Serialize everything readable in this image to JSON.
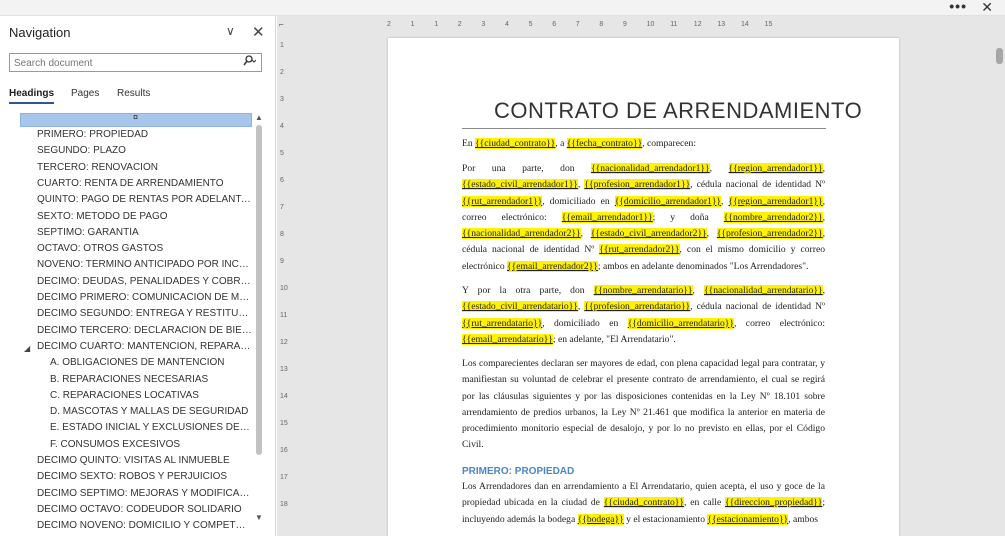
{
  "window": {
    "more_label": "•••",
    "close_label": "✕"
  },
  "navigation": {
    "title": "Navigation",
    "options_icon": "chevron-down-icon",
    "options_label": "∨",
    "close_label": "✕",
    "search": {
      "placeholder": "Search document",
      "icon": "search-icon"
    },
    "tabs": [
      "Headings",
      "Pages",
      "Results"
    ],
    "selected_label": "¤",
    "headings": [
      "PRIMERO: PROPIEDAD",
      "SEGUNDO: PLAZO",
      "TERCERO: RENOVACIÓN",
      "CUARTO: RENTA DE ARRENDAMIENTO",
      "QUINTO: PAGO DE RENTAS POR ADELANTADO",
      "SEXTO: MÉTODO DE PAGO",
      "SÉPTIMO: GARANTÍA",
      "OCTAVO: OTROS GASTOS",
      "NOVENO: TÉRMINO ANTICIPADO POR INCUMPLI...",
      "DÉCIMO: DEUDAS, PENALIDADES Y COBRANZA",
      "DÉCIMO PRIMERO: COMUNICACIÓN DE MOROS...",
      "DÉCIMO SEGUNDO: ENTREGA Y RESTITUCIÓN D...",
      "DÉCIMO TERCERO: DECLARACIÓN DE BIENES M...",
      "DÉCIMO CUARTO: MANTENCIÓN, REPARACIONE..."
    ],
    "subheadings": [
      "A. OBLIGACIONES DE MANTENCIÓN",
      "B. REPARACIONES NECESARIAS",
      "C. REPARACIONES LOCATIVAS",
      "D. MASCOTAS Y MALLAS DE SEGURIDAD",
      "E. ESTADO INICIAL Y EXCLUSIONES DE RESPO...",
      "F. CONSUMOS EXCESIVOS"
    ],
    "headings_after": [
      "DÉCIMO QUINTO: VISITAS AL INMUEBLE",
      "DÉCIMO SEXTO: ROBOS Y PERJUICIOS",
      "DÉCIMO SÉPTIMO: MEJORAS Y MODIFICACIONES",
      "DÉCIMO OCTAVO: CODEUDOR SOLIDARIO",
      "DÉCIMO NOVENO: DOMICILIO Y COMPETENCIA"
    ]
  },
  "ruler": {
    "horizontal": [
      "2",
      "1",
      "1",
      "2",
      "3",
      "4",
      "5",
      "6",
      "7",
      "8",
      "9",
      "10",
      "11",
      "12",
      "13",
      "14",
      "15"
    ],
    "vertical": [
      "1",
      "2",
      "3",
      "4",
      "5",
      "6",
      "7",
      "8",
      "9",
      "10",
      "11",
      "12",
      "13",
      "14",
      "15",
      "16",
      "17",
      "18"
    ]
  },
  "document": {
    "title": "CONTRATO DE ARRENDAMIENTO",
    "p1": [
      {
        "t": "En "
      },
      {
        "t": "{{ciudad_contrato}}",
        "h": true
      },
      {
        "t": ", a "
      },
      {
        "t": "{{fecha_contrato}}",
        "h": true
      },
      {
        "t": ", comparecen:"
      }
    ],
    "p2": [
      {
        "t": "Por una parte, don "
      },
      {
        "t": "{{nacionalidad_arrendador1}}",
        "h": true
      },
      {
        "t": ", "
      },
      {
        "t": "{{region_arrendador1}}",
        "h": true
      },
      {
        "t": ", "
      },
      {
        "t": "{{estado_civil_arrendador1}}",
        "h": true
      },
      {
        "t": ", "
      },
      {
        "t": "{{profesion_arrendador1}}",
        "h": true
      },
      {
        "t": ", cédula nacional de identidad Nº "
      },
      {
        "t": "{{rut_arrendador1}}",
        "h": true
      },
      {
        "t": ", domiciliado en "
      },
      {
        "t": "{{domicilio_arrendador1}}",
        "h": true
      },
      {
        "t": ", "
      },
      {
        "t": "{{region_arrendador1}}",
        "h": true
      },
      {
        "t": ", correo electrónico: "
      },
      {
        "t": "{{email_arrendador1}}",
        "h": true
      },
      {
        "t": "; y doña "
      },
      {
        "t": "{{nombre_arrendador2}}",
        "h": true
      },
      {
        "t": ", "
      },
      {
        "t": "{{nacionalidad_arrendador2}}",
        "h": true
      },
      {
        "t": ", "
      },
      {
        "t": "{{estado_civil_arrendador2}}",
        "h": true
      },
      {
        "t": ", "
      },
      {
        "t": "{{profesion_arrendador2}}",
        "h": true
      },
      {
        "t": ", cédula nacional de identidad Nº "
      },
      {
        "t": "{{rut_arrendador2}}",
        "h": true
      },
      {
        "t": ", con el mismo domicilio y correo electrónico "
      },
      {
        "t": "{{email_arrendador2}}",
        "h": true
      },
      {
        "t": "; ambos en adelante denominados \"Los Arrendadores\"."
      }
    ],
    "p3": [
      {
        "t": "Y por la otra parte, don "
      },
      {
        "t": "{{nombre_arrendatario}}",
        "h": true
      },
      {
        "t": ", "
      },
      {
        "t": "{{nacionalidad_arrendatario}}",
        "h": true
      },
      {
        "t": ", "
      },
      {
        "t": "{{estado_civil_arrendatario}}",
        "h": true
      },
      {
        "t": ", "
      },
      {
        "t": "{{profesion_arrendatario}}",
        "h": true
      },
      {
        "t": ", cédula nacional de identidad Nº "
      },
      {
        "t": "{{rut_arrendatario}}",
        "h": true
      },
      {
        "t": ", domiciliado en "
      },
      {
        "t": "{{domicilio_arrendatario}}",
        "h": true
      },
      {
        "t": ", correo electrónico: "
      },
      {
        "t": "{{email_arrendatario}}",
        "h": true
      },
      {
        "t": "; en adelante, \"El Arrendatario\"."
      }
    ],
    "p4": [
      {
        "t": "Los comparecientes declaran ser mayores de edad, con plena capacidad legal para contratar, y manifiestan su voluntad de celebrar el presente contrato de arrendamiento, el cual se regirá por las cláusulas siguientes y por las disposiciones contenidas en la Ley Nº 18.101 sobre arrendamiento de predios urbanos, la Ley Nº 21.461 que modifica la anterior en materia de procedimiento monitorio especial de desalojo, y por lo no previsto en ellas, por el Código Civil."
      }
    ],
    "section_heading": "PRIMERO: PROPIEDAD",
    "p5": [
      {
        "t": "Los Arrendadores dan en arrendamiento a El Arrendatario, quien acepta, el uso y goce de la propiedad ubicada en la ciudad de "
      },
      {
        "t": "{{ciudad_contrato}}",
        "h": true
      },
      {
        "t": ", en calle "
      },
      {
        "t": "{{direccion_propiedad}}",
        "h": true
      },
      {
        "t": "; incluyendo además la bodega "
      },
      {
        "t": "{{bodega}}",
        "h": true
      },
      {
        "t": " y el estacionamiento "
      },
      {
        "t": "{{estacionamiento}}",
        "h": true
      },
      {
        "t": ", ambos"
      }
    ]
  },
  "colors": {
    "highlight": "#fff200",
    "heading_blue": "#4a86c5",
    "selection": "#a8c6ec",
    "tab_underline": "#2b579a"
  }
}
